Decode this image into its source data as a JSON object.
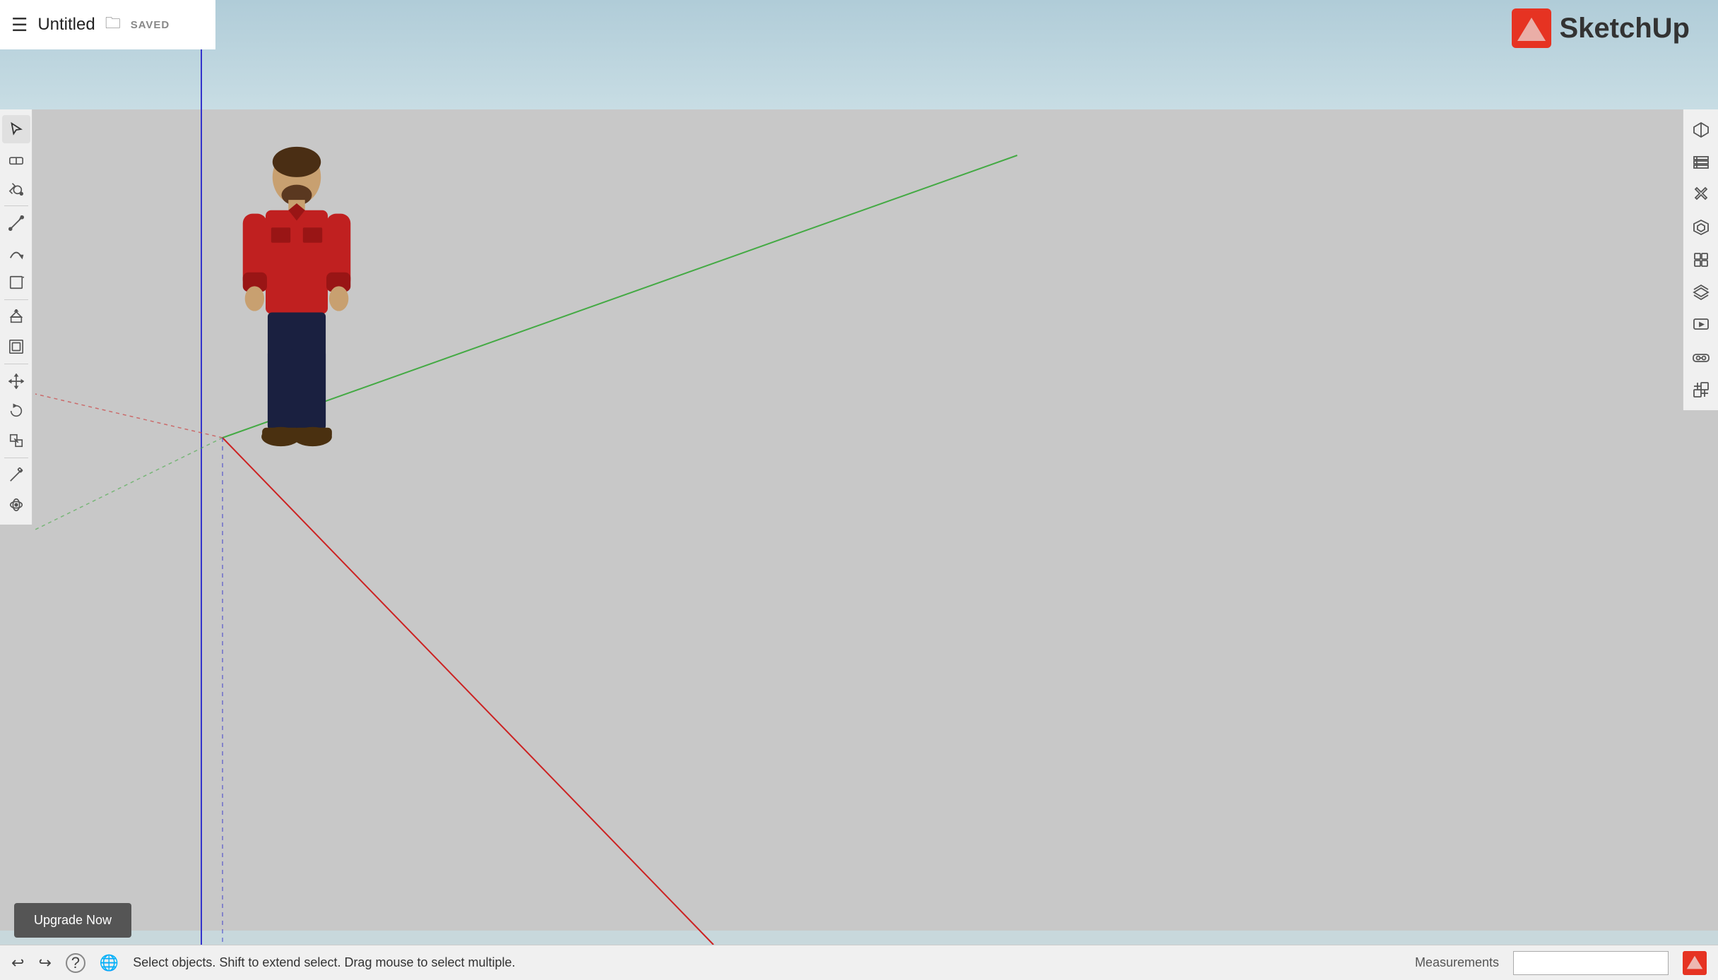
{
  "header": {
    "title": "Untitled",
    "saved_label": "SAVED"
  },
  "logo": {
    "text": "SketchUp"
  },
  "status_bar": {
    "message": "Select objects. Shift to extend select. Drag mouse to select multiple.",
    "measurements_label": "Measurements"
  },
  "upgrade_btn": {
    "label": "Upgrade Now"
  },
  "left_tools": [
    {
      "name": "select",
      "icon": "↖",
      "title": "Select"
    },
    {
      "name": "eraser",
      "icon": "⊘",
      "title": "Eraser"
    },
    {
      "name": "paint-bucket",
      "icon": "⬡",
      "title": "Paint Bucket"
    },
    {
      "name": "line",
      "icon": "✏",
      "title": "Line"
    },
    {
      "name": "arc",
      "icon": "⌒",
      "title": "Arc"
    },
    {
      "name": "shapes",
      "icon": "▭",
      "title": "Shapes"
    },
    {
      "name": "push-pull",
      "icon": "⬡",
      "title": "Push/Pull"
    },
    {
      "name": "offset",
      "icon": "⬜",
      "title": "Offset"
    },
    {
      "name": "move",
      "icon": "✥",
      "title": "Move"
    },
    {
      "name": "rotate",
      "icon": "↻",
      "title": "Rotate"
    },
    {
      "name": "scale",
      "icon": "⤡",
      "title": "Scale"
    },
    {
      "name": "tape-measure",
      "icon": "📏",
      "title": "Tape Measure"
    },
    {
      "name": "orbit",
      "icon": "⊕",
      "title": "Orbit"
    }
  ],
  "right_tools": [
    {
      "name": "materials",
      "icon": "◈",
      "title": "Materials"
    },
    {
      "name": "components",
      "icon": "⊟",
      "title": "Components"
    },
    {
      "name": "styles",
      "icon": "🎓",
      "title": "Styles"
    },
    {
      "name": "3d-warehouse",
      "icon": "⬡",
      "title": "3D Warehouse"
    },
    {
      "name": "solid-tools",
      "icon": "⬡",
      "title": "Solid Tools"
    },
    {
      "name": "layers",
      "icon": "≡",
      "title": "Layers"
    },
    {
      "name": "scenes",
      "icon": "🎬",
      "title": "Scenes"
    },
    {
      "name": "vr",
      "icon": "👓",
      "title": "VR"
    },
    {
      "name": "extension",
      "icon": "⬡",
      "title": "Extension"
    }
  ],
  "colors": {
    "sky_top": "#b0ccd8",
    "sky_bottom": "#c8dde4",
    "ground": "#c8c8c8",
    "axis_green": "#44aa44",
    "axis_red": "#cc2222",
    "axis_blue": "#3333cc",
    "axis_dotted": "#bb4444"
  }
}
